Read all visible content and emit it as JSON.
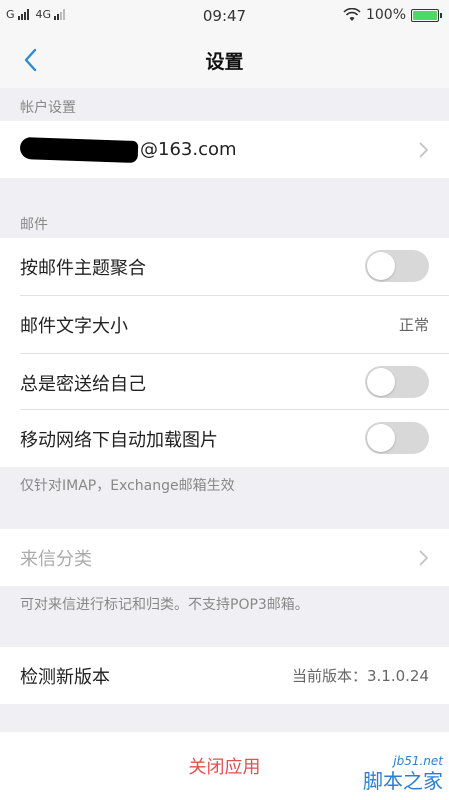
{
  "status_bar": {
    "carrier1": "G",
    "carrier2": "4G",
    "time": "09:47",
    "battery": "100%",
    "battery_level": 1.0
  },
  "nav": {
    "title": "设置"
  },
  "account_section": {
    "header": "帐户设置",
    "email_suffix": "@163.com"
  },
  "mail_section": {
    "header": "邮件",
    "rows": [
      {
        "label": "按邮件主题聚合",
        "toggle": false
      },
      {
        "label": "邮件文字大小",
        "value": "正常"
      },
      {
        "label": "总是密送给自己",
        "toggle": false
      },
      {
        "label": "移动网络下自动加载图片",
        "toggle": false
      }
    ],
    "note": "仅针对IMAP，Exchange邮箱生效"
  },
  "classify": {
    "label": "来信分类",
    "note": "可对来信进行标记和归类。不支持POP3邮箱。"
  },
  "update": {
    "label": "检测新版本",
    "value": "当前版本：3.1.0.24"
  },
  "close_app": {
    "label": "关闭应用"
  },
  "watermark": {
    "site": "jb51.net",
    "name": "脚本之家"
  },
  "colors": {
    "accent": "#2a8cd8",
    "danger": "#e0524d",
    "background": "#efeff4"
  }
}
